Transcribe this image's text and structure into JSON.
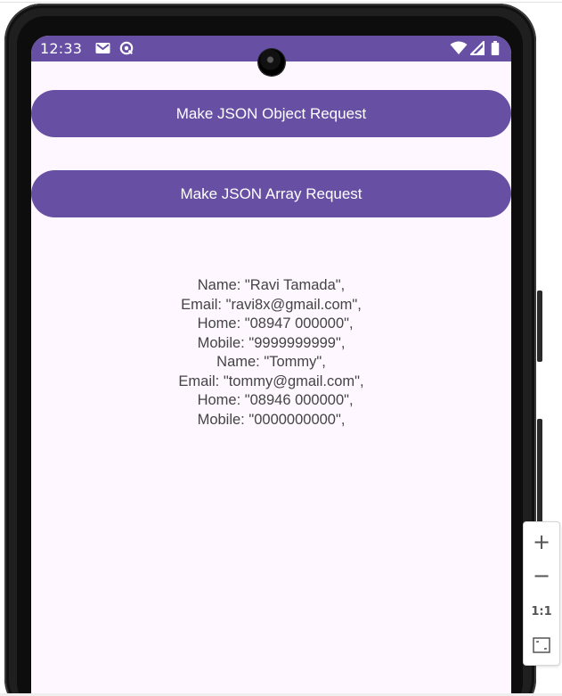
{
  "statusbar": {
    "time": "12:33",
    "left_icons": [
      "gmail-icon",
      "sync-icon"
    ],
    "right_icons": [
      "wifi-icon",
      "signal-icon",
      "battery-icon"
    ]
  },
  "buttons": {
    "object_label": "Make JSON Object Request",
    "array_label": "Make JSON Array Request"
  },
  "response_lines": [
    "Name: \"Ravi Tamada\",",
    "Email: \"ravi8x@gmail.com\",",
    "  Home: \"08947 000000\",",
    "Mobile: \"9999999999\",",
    "Name: \"Tommy\",",
    "Email: \"tommy@gmail.com\",",
    "  Home: \"08946 000000\",",
    "Mobile: \"0000000000\","
  ],
  "zoom_panel": {
    "zoom_in": "+",
    "zoom_out": "−",
    "actual_size": "1:1",
    "fit_icon": "fit-screen-icon"
  },
  "colors": {
    "primary": "#6750a4",
    "background": "#fef7ff",
    "text": "#444444"
  }
}
